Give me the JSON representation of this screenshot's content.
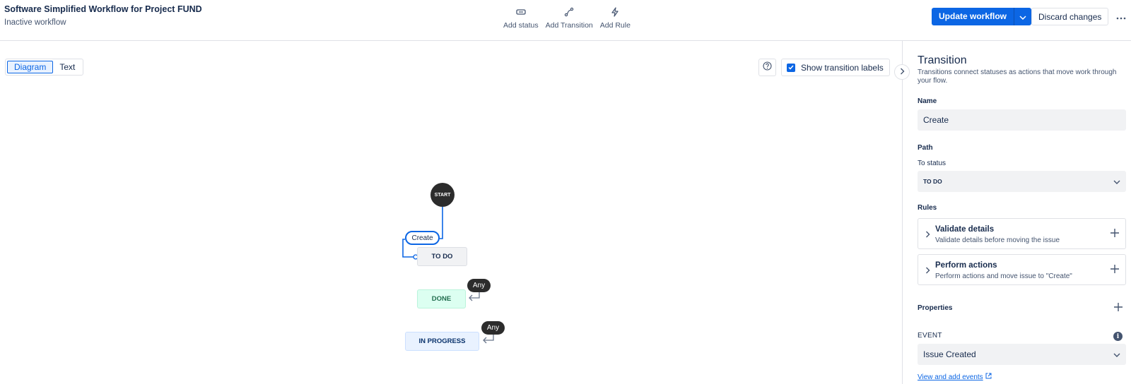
{
  "header": {
    "title": "Software Simplified Workflow for Project FUND",
    "subtitle": "Inactive workflow",
    "toolbar": {
      "add_status": "Add status",
      "add_transition": "Add Transition",
      "add_rule": "Add Rule"
    },
    "update_label": "Update workflow",
    "discard_label": "Discard changes"
  },
  "canvas": {
    "view_toggle": {
      "diagram": "Diagram",
      "text": "Text",
      "selected": "Diagram"
    },
    "show_labels": {
      "label": "Show transition labels",
      "checked": true
    },
    "nodes": {
      "start": "START",
      "todo": "TO DO",
      "done": "DONE",
      "in_progress": "IN PROGRESS"
    },
    "transitions": {
      "create": "Create",
      "any_done": "Any",
      "any_in_progress": "Any"
    }
  },
  "panel": {
    "title": "Transition",
    "description": "Transitions connect statuses as actions that move work through your flow.",
    "name_label": "Name",
    "name_value": "Create",
    "path_label": "Path",
    "to_status_label": "To status",
    "to_status_value": "TO DO",
    "rules_label": "Rules",
    "rules": [
      {
        "title": "Validate details",
        "desc": "Validate details before moving the issue"
      },
      {
        "title": "Perform actions",
        "desc": "Perform actions and move issue to \"Create\""
      }
    ],
    "properties_label": "Properties",
    "event_label": "EVENT",
    "event_value": "Issue Created",
    "events_link": "View and add events"
  },
  "colors": {
    "accent": "#0c66e4",
    "todo_bg": "#f1f2f4",
    "done_bg": "#dcfff1",
    "in_progress_bg": "#e9f2ff"
  }
}
